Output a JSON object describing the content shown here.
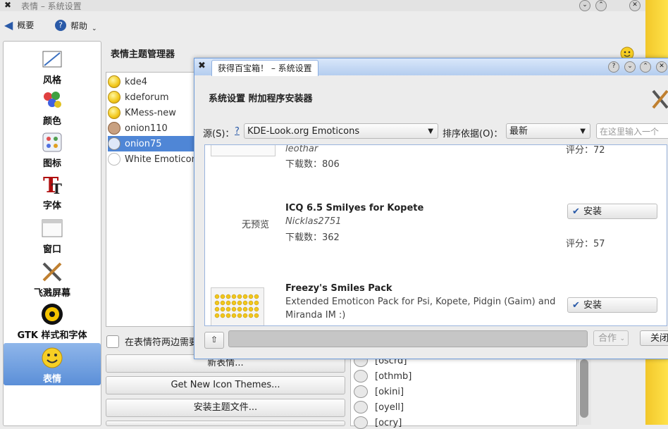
{
  "window": {
    "title": "表情 – 系统设置"
  },
  "toolbar": {
    "overview_label": "概要",
    "help_label": "帮助"
  },
  "sidebar": {
    "items": [
      {
        "label": "风格",
        "icon": "style-icon"
      },
      {
        "label": "颜色",
        "icon": "color-palette-icon"
      },
      {
        "label": "图标",
        "icon": "icons-icon"
      },
      {
        "label": "字体",
        "icon": "font-icon"
      },
      {
        "label": "窗口",
        "icon": "window-icon"
      },
      {
        "label": "飞溅屏幕",
        "icon": "splash-tools-icon"
      },
      {
        "label": "GTK 样式和字体",
        "icon": "gtk-icon"
      },
      {
        "label": "表情",
        "icon": "smiley-icon"
      }
    ]
  },
  "main": {
    "title": "表情主题管理器",
    "themes": [
      "kde4",
      "kdeforum",
      "KMess-new",
      "onion110",
      "onion75",
      "White Emoticons"
    ],
    "selected_theme": "onion75",
    "checkbox_label": "在表情符两边需要",
    "buttons": {
      "new_theme": "新表情...",
      "get_new": "Get New Icon Themes...",
      "install_file": "安装主题文件..."
    },
    "emoticons": [
      "[oscrd]",
      "[othmb]",
      "[okini]",
      "[oyell]",
      "[ocry]"
    ]
  },
  "dialog": {
    "title": "获得百宝箱！ – 系统设置",
    "heading": "系统设置 附加程序安装器",
    "source_label": "源(S)：",
    "source_help": "?",
    "source_value": "KDE-Look.org Emoticons",
    "sort_label": "排序依据(O)：",
    "sort_value": "最新",
    "search_placeholder": "在这里输入一个",
    "no_preview": "无预览",
    "results": [
      {
        "author": "leothar",
        "downloads": "下载数：806",
        "rating": "评分：72"
      },
      {
        "name": "ICQ 6.5 Smilyes for Kopete",
        "author": "Nicklas2751",
        "downloads": "下载数：362",
        "rating": "评分：57",
        "install": "安装"
      },
      {
        "name": "Freezy's Smiles Pack",
        "desc1": "Extended Emoticon Pack for Psi, Kopete, Pidgin (Gaim) and",
        "desc2": "Miranda IM :)",
        "install": "安装"
      }
    ],
    "action_label": "合作",
    "close_label": "关闭"
  },
  "colors": {
    "accent": "#5b8fd8",
    "dialog_border": "#6e9bd9",
    "side_bar_yellow": "#f2c72a"
  }
}
